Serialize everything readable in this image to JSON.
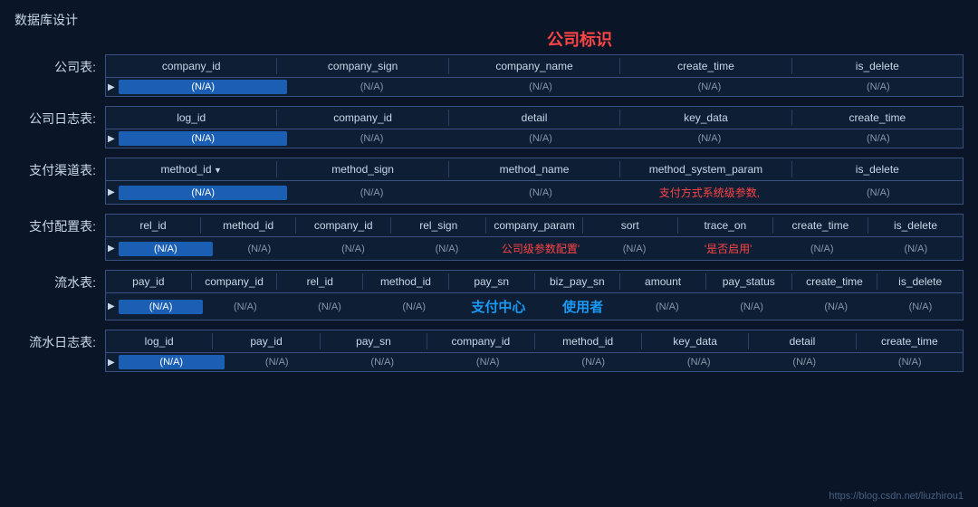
{
  "page": {
    "title": "数据库设计",
    "centerLabel": "公司标识",
    "watermark": "https://blog.csdn.net/liuzhirou1"
  },
  "tables": [
    {
      "label": "公司表:",
      "headers": [
        "company_id",
        "company_sign",
        "company_name",
        "create_time",
        "is_delete"
      ],
      "dataRow": [
        "(N/A)",
        "(N/A)",
        "(N/A)",
        "(N/A)",
        "(N/A)"
      ],
      "highlightIndex": 0
    },
    {
      "label": "公司日志表:",
      "headers": [
        "log_id",
        "company_id",
        "detail",
        "key_data",
        "create_time"
      ],
      "dataRow": [
        "(N/A)",
        "(N/A)",
        "(N/A)",
        "(N/A)",
        "(N/A)"
      ],
      "highlightIndex": 0
    },
    {
      "label": "支付渠道表:",
      "headers": [
        "method_id",
        "method_sign",
        "method_name",
        "method_system_param",
        "is_delete"
      ],
      "headerSort": 0,
      "dataRow": [
        "(N/A)",
        "(N/A)",
        "(N/A)",
        "支付方式系统级参数,",
        "(N/A)"
      ],
      "highlightIndex": 0,
      "redIndex": 3
    },
    {
      "label": "支付配置表:",
      "headers": [
        "rel_id",
        "method_id",
        "company_id",
        "rel_sign",
        "company_param",
        "sort",
        "trace_on",
        "create_time",
        "is_delete"
      ],
      "dataRow": [
        "(N/A)",
        "(N/A)",
        "(N/A)",
        "(N/A)",
        "公司级参数配置'",
        "(N/A)",
        "'是否启用'",
        "(N/A)",
        "(N/A)"
      ],
      "highlightIndex": 0,
      "redIndex": 4,
      "red2Index": 6
    },
    {
      "label": "流水表:",
      "headers": [
        "pay_id",
        "company_id",
        "rel_id",
        "method_id",
        "pay_sn",
        "biz_pay_sn",
        "amount",
        "pay_status",
        "create_time",
        "is_delete"
      ],
      "dataRow": [
        "(N/A)",
        "(N/A)",
        "(N/A)",
        "(N/A)",
        "支付中心",
        "使用者",
        "(N/A)",
        "(N/A)",
        "(N/A)",
        "(N/A)"
      ],
      "highlightIndex": 0,
      "blueTextIndex": [
        4,
        5
      ]
    },
    {
      "label": "流水日志表:",
      "headers": [
        "log_id",
        "pay_id",
        "pay_sn",
        "company_id",
        "method_id",
        "key_data",
        "detail",
        "create_time"
      ],
      "dataRow": [
        "(N/A)",
        "(N/A)",
        "(N/A)",
        "(N/A)",
        "(N/A)",
        "(N/A)",
        "(N/A)",
        "(N/A)"
      ],
      "highlightIndex": 0
    }
  ]
}
